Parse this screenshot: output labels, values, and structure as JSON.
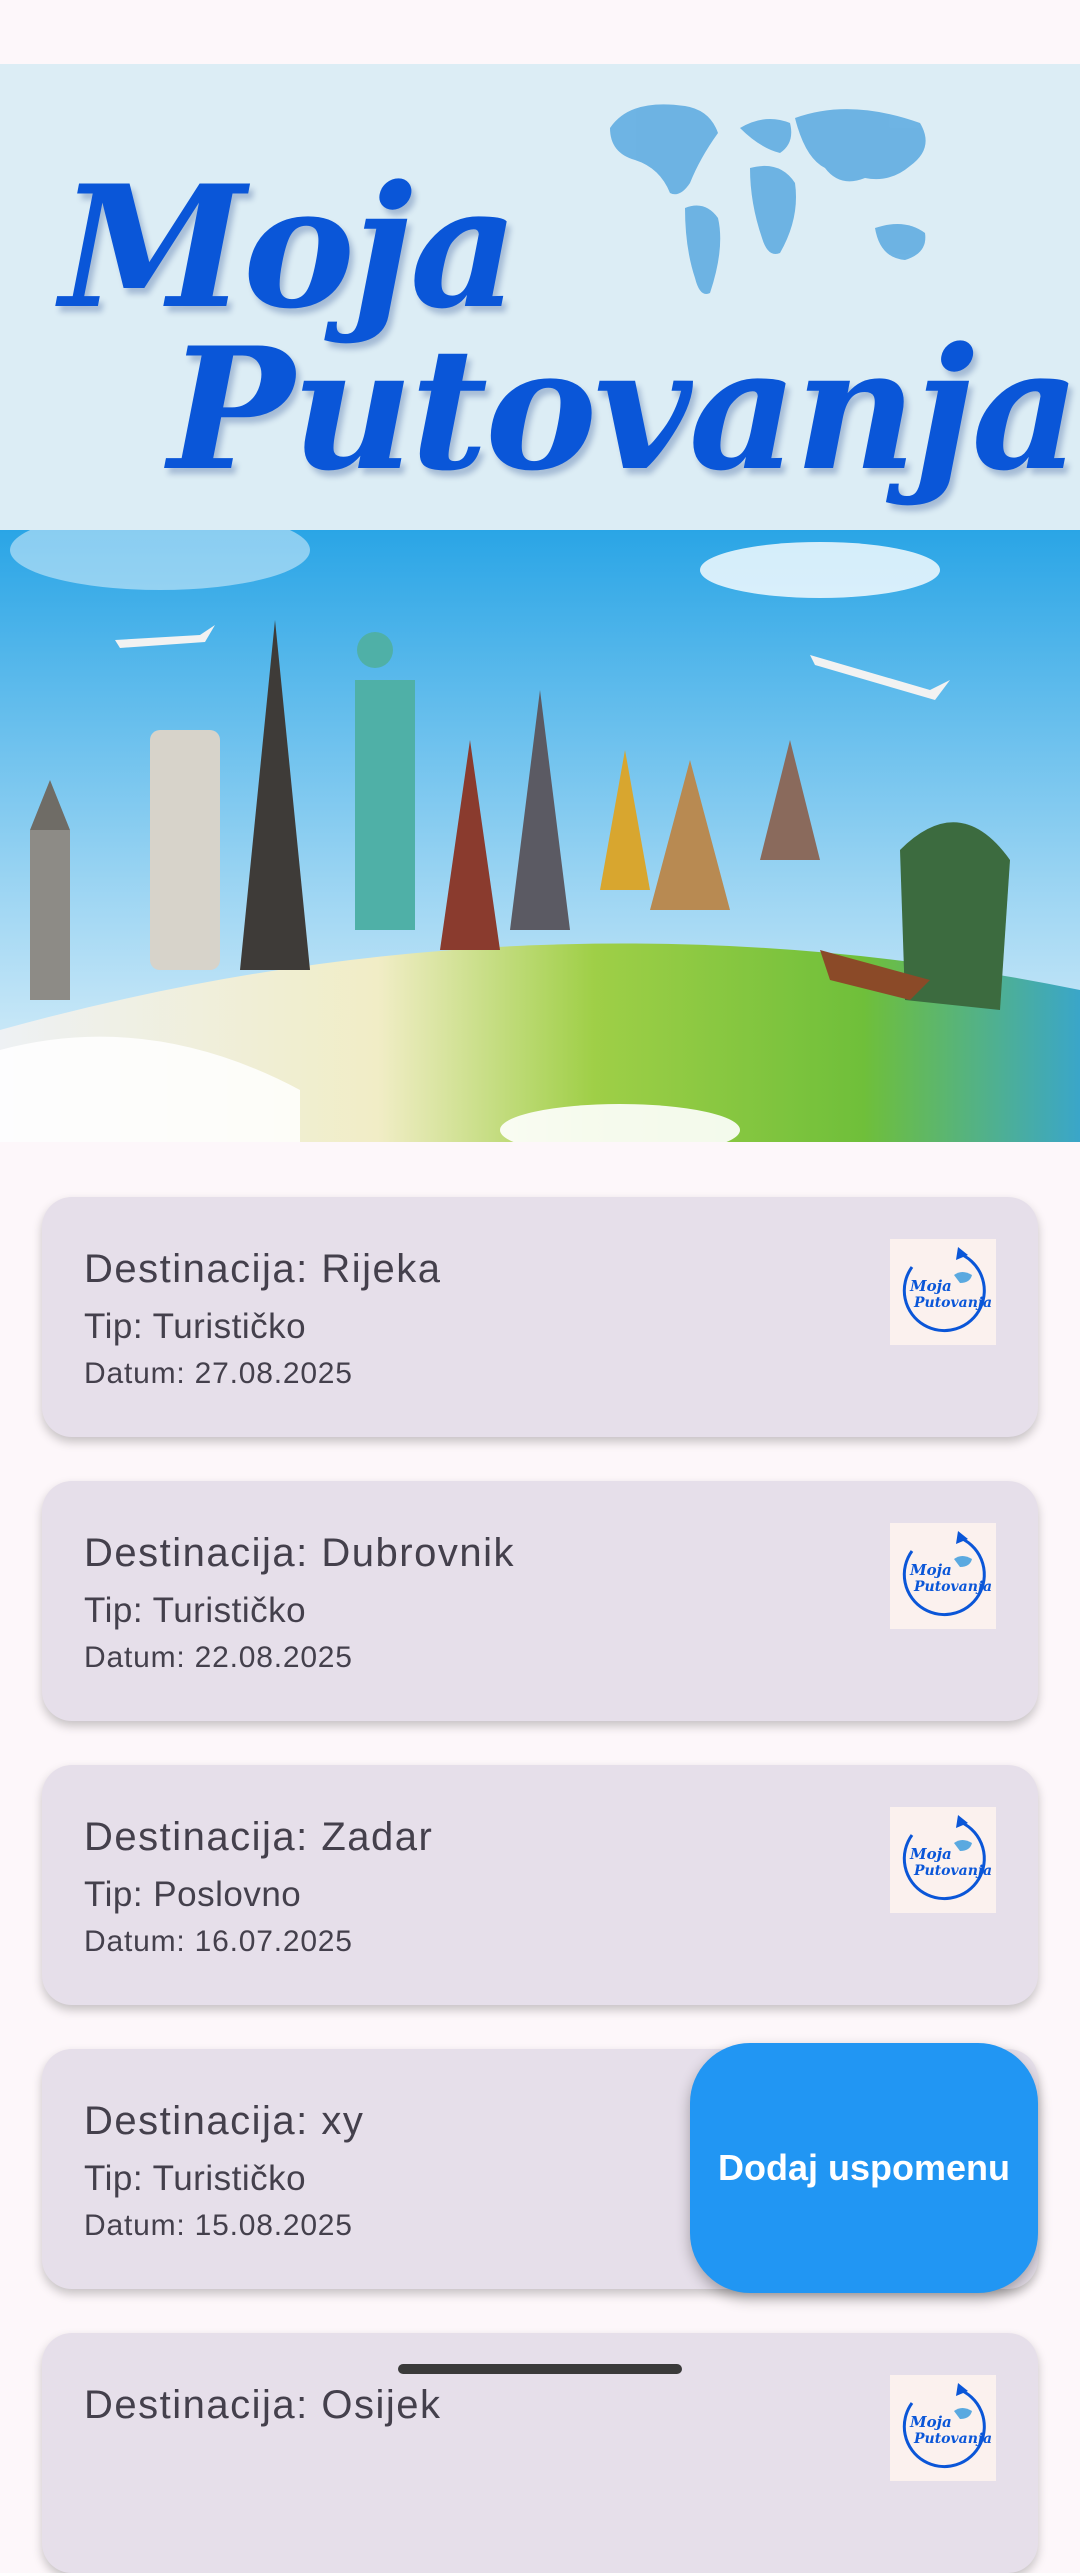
{
  "header": {
    "logo_line1": "Moja",
    "logo_line2": "Putovanja"
  },
  "thumbnail": {
    "line1": "Moja",
    "line2": "Putovanja"
  },
  "trips": [
    {
      "destination": "Destinacija: Rijeka",
      "type": "Tip: Turističko",
      "date": "Datum: 27.08.2025"
    },
    {
      "destination": "Destinacija: Dubrovnik",
      "type": "Tip: Turističko",
      "date": "Datum: 22.08.2025"
    },
    {
      "destination": "Destinacija: Zadar",
      "type": "Tip: Poslovno",
      "date": "Datum: 16.07.2025"
    },
    {
      "destination": "Destinacija: xy",
      "type": "Tip: Turističko",
      "date": "Datum: 15.08.2025"
    },
    {
      "destination": "Destinacija: Osijek",
      "type": "",
      "date": ""
    }
  ],
  "fab": {
    "label": "Dodaj uspomenu"
  },
  "colors": {
    "brand_blue": "#0a56d8",
    "fab": "#2196f3",
    "card": "#e6dfea"
  }
}
